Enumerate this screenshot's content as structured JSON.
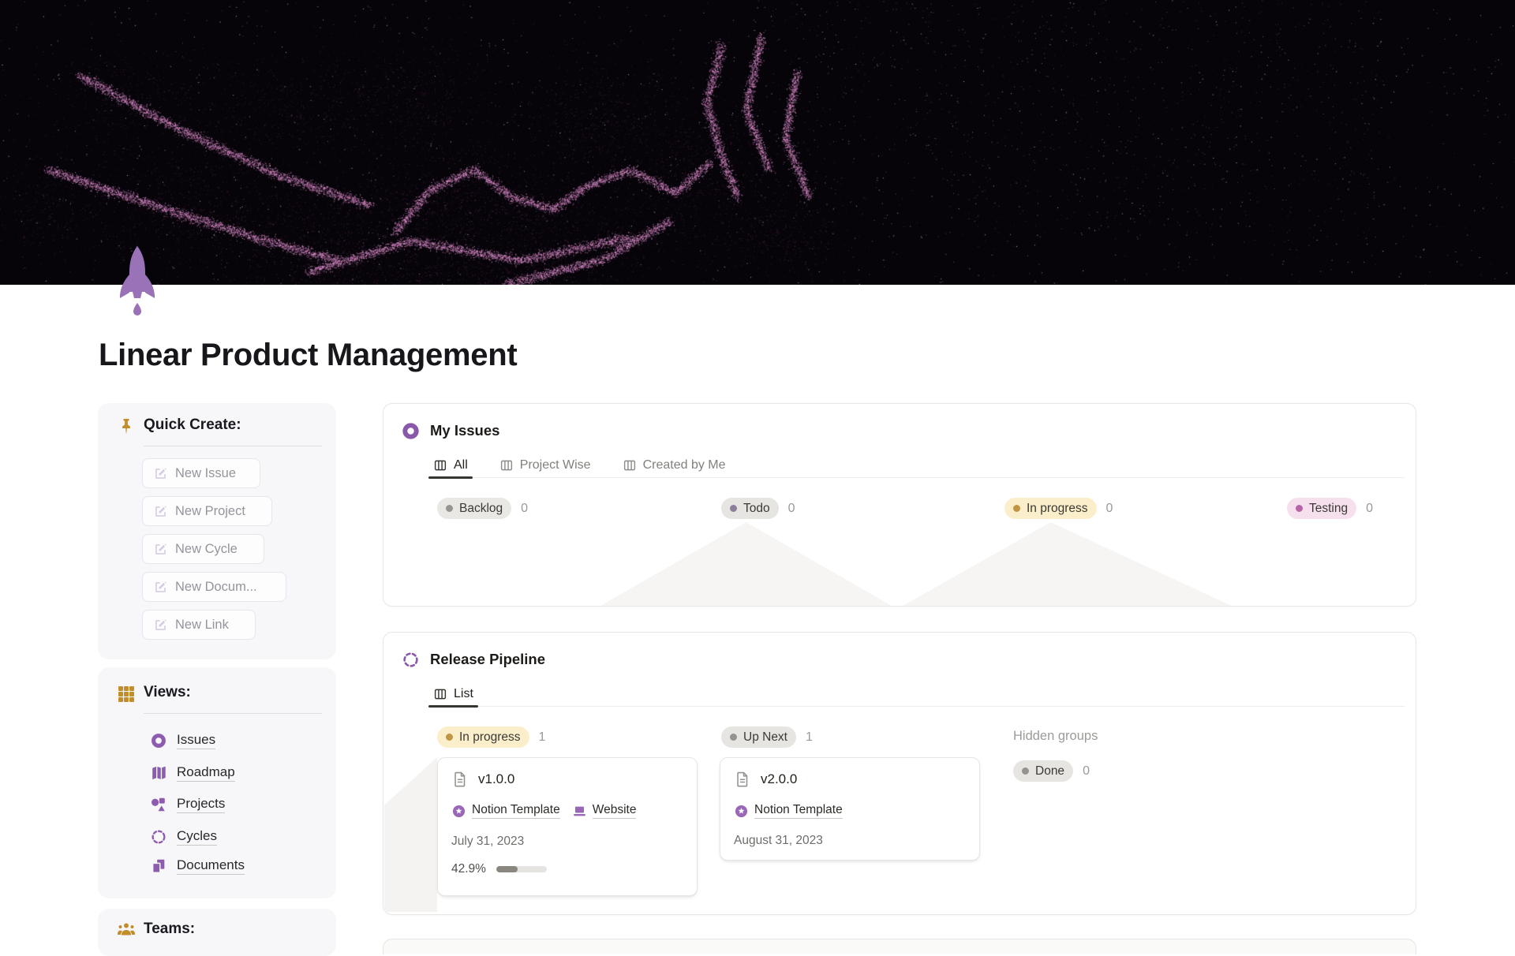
{
  "page": {
    "title": "Linear Product Management",
    "icon": "rocket"
  },
  "sidebar": {
    "quick_create": {
      "heading": "Quick Create:",
      "buttons": [
        {
          "label": "New Issue"
        },
        {
          "label": "New Project"
        },
        {
          "label": "New Cycle"
        },
        {
          "label": "New Docum..."
        },
        {
          "label": "New Link"
        }
      ]
    },
    "views": {
      "heading": "Views:",
      "items": [
        {
          "label": "Issues",
          "icon": "issues-icon"
        },
        {
          "label": "Roadmap",
          "icon": "roadmap-icon"
        },
        {
          "label": "Projects",
          "icon": "projects-icon"
        },
        {
          "label": "Cycles",
          "icon": "cycles-icon"
        },
        {
          "label": "Documents",
          "icon": "documents-icon"
        }
      ]
    },
    "teams": {
      "heading": "Teams:"
    }
  },
  "main": {
    "my_issues": {
      "title": "My Issues",
      "tabs": [
        {
          "label": "All",
          "active": true
        },
        {
          "label": "Project Wise",
          "active": false
        },
        {
          "label": "Created by Me",
          "active": false
        }
      ],
      "columns": [
        {
          "label": "Backlog",
          "count": "0",
          "color": "gray"
        },
        {
          "label": "Todo",
          "count": "0",
          "color": "gray"
        },
        {
          "label": "In progress",
          "count": "0",
          "color": "yellow"
        },
        {
          "label": "Testing",
          "count": "0",
          "color": "pink"
        }
      ]
    },
    "release_pipeline": {
      "title": "Release Pipeline",
      "tabs": [
        {
          "label": "List",
          "active": true
        }
      ],
      "columns": [
        {
          "label": "In progress",
          "count": "1",
          "color": "yellow"
        },
        {
          "label": "Up Next",
          "count": "1",
          "color": "gray"
        }
      ],
      "hidden_groups": {
        "label": "Hidden groups",
        "pills": [
          {
            "label": "Done",
            "count": "0"
          }
        ]
      },
      "cards": [
        {
          "title": "v1.0.0",
          "links": [
            {
              "label": "Notion Template",
              "icon": "notion-template-icon"
            },
            {
              "label": "Website",
              "icon": "website-icon"
            }
          ],
          "date": "July 31, 2023",
          "progress_label": "42.9%",
          "progress_pct": 42.9
        },
        {
          "title": "v2.0.0",
          "links": [
            {
              "label": "Notion Template",
              "icon": "notion-template-icon"
            }
          ],
          "date": "August 31, 2023"
        }
      ]
    }
  },
  "colors": {
    "accent_purple": "#9065b0",
    "accent_gold": "#c28e2b",
    "pill_yellow_bg": "#fbeecb",
    "pill_pink_bg": "#f6e0ee",
    "pill_gray_bg": "#e9e8e5",
    "dot_gold": "#c09543",
    "dot_pink": "#b765a6",
    "dot_gray": "#979592",
    "dot_todo": "#8d7f9b",
    "text_dark": "#1d1b18",
    "text_gray": "#87857f"
  }
}
